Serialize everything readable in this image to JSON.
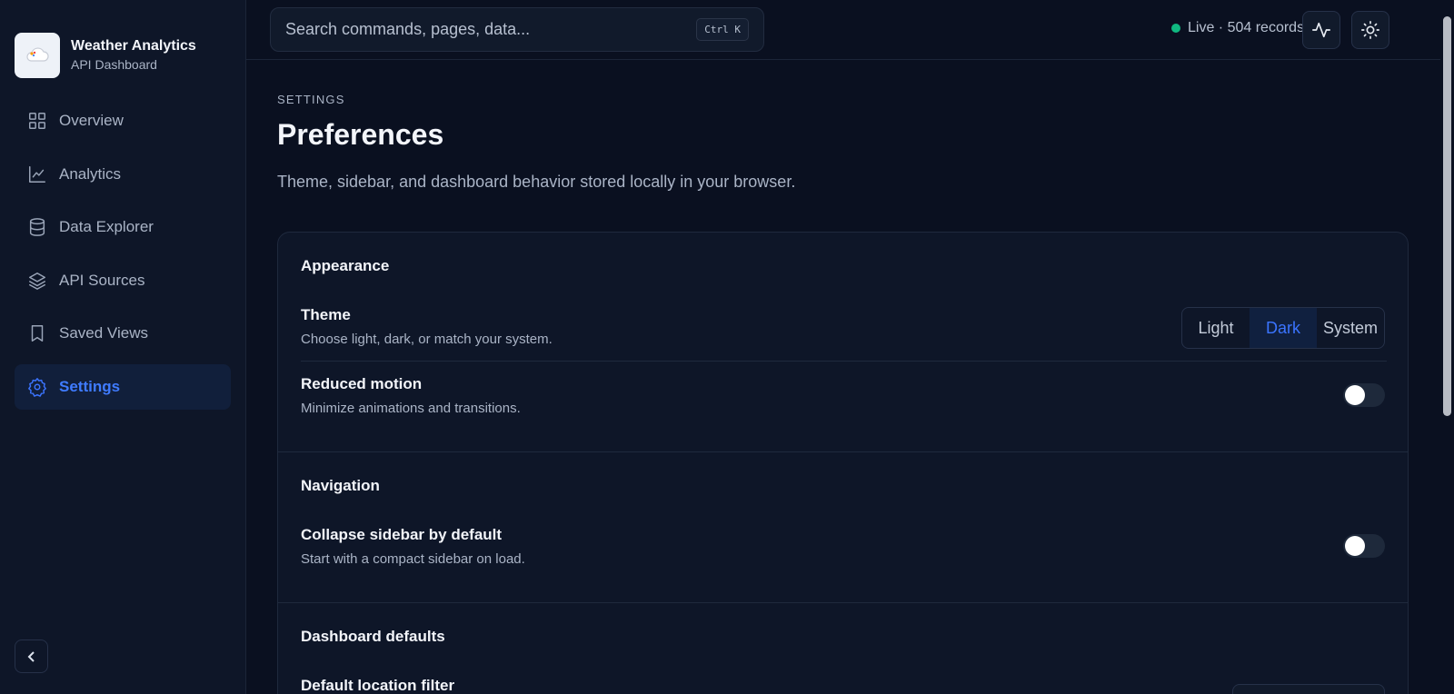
{
  "brand": {
    "name": "Weather Analytics",
    "subtitle": "API Dashboard"
  },
  "sidebar": {
    "items": [
      {
        "label": "Overview",
        "icon": "grid-icon",
        "active": false
      },
      {
        "label": "Analytics",
        "icon": "line-chart-icon",
        "active": false
      },
      {
        "label": "Data Explorer",
        "icon": "database-icon",
        "active": false
      },
      {
        "label": "API Sources",
        "icon": "layers-icon",
        "active": false
      },
      {
        "label": "Saved Views",
        "icon": "bookmark-icon",
        "active": false
      },
      {
        "label": "Settings",
        "icon": "gear-icon",
        "active": true
      }
    ]
  },
  "topbar": {
    "search_placeholder": "Search commands, pages, data...",
    "shortcut": "Ctrl K",
    "status": "Live · 504 records",
    "status_color": "#10b981"
  },
  "page": {
    "eyebrow": "SETTINGS",
    "title": "Preferences",
    "description": "Theme, sidebar, and dashboard behavior stored locally in your browser."
  },
  "settings": {
    "appearance": {
      "title": "Appearance",
      "theme": {
        "label": "Theme",
        "description": "Choose light, dark, or match your system.",
        "options": [
          "Light",
          "Dark",
          "System"
        ],
        "selected": "Dark"
      },
      "reduced_motion": {
        "label": "Reduced motion",
        "description": "Minimize animations and transitions.",
        "enabled": false
      }
    },
    "navigation": {
      "title": "Navigation",
      "collapse_sidebar": {
        "label": "Collapse sidebar by default",
        "description": "Start with a compact sidebar on load.",
        "enabled": false
      }
    },
    "dashboard_defaults": {
      "title": "Dashboard defaults",
      "location_filter": {
        "label": "Default location filter"
      }
    }
  },
  "colors": {
    "accent": "#3b74ff",
    "background": "#0a1020",
    "surface": "#0e1628"
  }
}
